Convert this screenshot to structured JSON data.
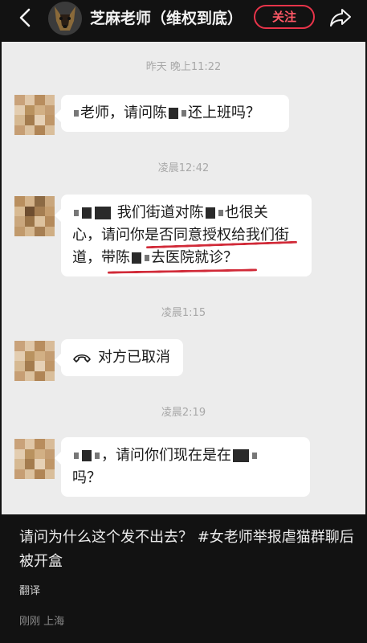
{
  "header": {
    "title": "芝麻老师（维权到底）",
    "follow_label": "关注",
    "colors": {
      "accent": "#e8344a",
      "background": "#121212"
    },
    "icons": {
      "back": "back-chevron-icon",
      "share": "share-arrow-icon"
    }
  },
  "chat": {
    "messages": [
      {
        "time": "昨天 晚上11:22",
        "parts": [
          "老师，请问陈",
          "还上班吗？"
        ]
      },
      {
        "time": "凌晨12:42",
        "lines": [
          "我们街道对陈",
          "也很关",
          "心，请问你是否同意授权给我们街",
          "道，带陈",
          "去医院就诊？"
        ]
      },
      {
        "time": "凌晨1:15",
        "text": "对方已取消",
        "icon": "call-cancelled-icon"
      },
      {
        "time": "凌晨2:19",
        "parts": [
          "，请问你们现在是在",
          "吗？"
        ]
      }
    ]
  },
  "caption": {
    "text": "请问为什么这个发不出去？ #女老师举报虐猫群聊后被开盒",
    "translate": "翻译",
    "time": "刚刚",
    "location": "上海"
  }
}
